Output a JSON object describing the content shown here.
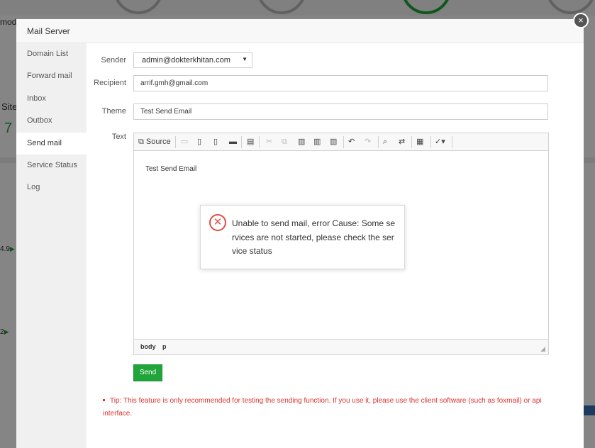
{
  "background": {
    "top_left_text": "mod",
    "side_label": "Site",
    "side_value": "7",
    "row1_value": "4.9",
    "row2_value": "2"
  },
  "dialog": {
    "title": "Mail Server",
    "close_glyph": "×",
    "menu": [
      {
        "label": "Domain List"
      },
      {
        "label": "Forward mail"
      },
      {
        "label": "Inbox"
      },
      {
        "label": "Outbox"
      },
      {
        "label": "Send mail"
      },
      {
        "label": "Service Status"
      },
      {
        "label": "Log"
      }
    ],
    "active_menu": "Send mail",
    "form": {
      "sender_label": "Sender",
      "sender_value": "admin@dokterkhitan.com",
      "recipient_label": "Recipient",
      "recipient_value": "arrif.gmh@gmail.com",
      "theme_label": "Theme",
      "theme_value": "Test Send Email",
      "text_label": "Text",
      "editor_content": "Test Send Email",
      "toolbar_source": "Source",
      "path": [
        "body",
        "p"
      ],
      "send_label": "Send",
      "tip": "Tip: This feature is only recommended for testing the sending function. If you use it, please use the client software (such as foxmail) or api interface."
    }
  },
  "error_toast": {
    "message": "Unable to send mail, error Cause: Some services are not started, please check the service status"
  },
  "colors": {
    "accent_green": "#20a53a",
    "error_red": "#e34a42",
    "tip_red": "#d33333"
  }
}
